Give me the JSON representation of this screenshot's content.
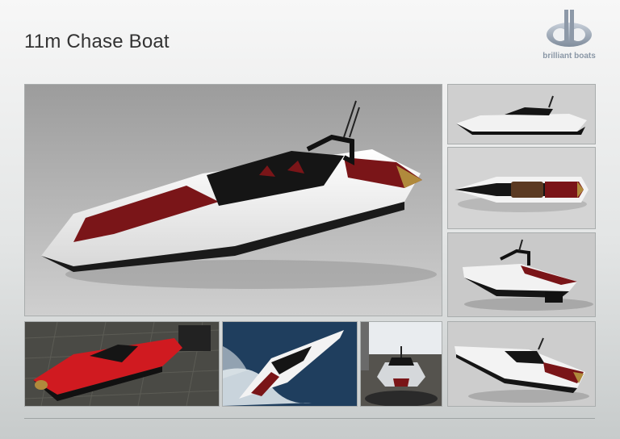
{
  "header": {
    "title": "11m Chase Boat"
  },
  "logo": {
    "text": "brilliant boats",
    "mark": "bb-monogram-icon"
  },
  "colors": {
    "hull_white": "#f4f4f4",
    "interior_red": "#7a1518",
    "carbon_black": "#151515",
    "studio_gray": "#b8b8b8",
    "logo_blue": "#8a97a6"
  },
  "gallery": [
    "main-render-three-quarter-view",
    "side-profile-render",
    "top-plan-render",
    "rear-three-quarter-render",
    "red-boat-on-quay-render",
    "boat-at-sea-aerial-render",
    "boat-in-marina-rear-render",
    "bow-three-quarter-render"
  ]
}
